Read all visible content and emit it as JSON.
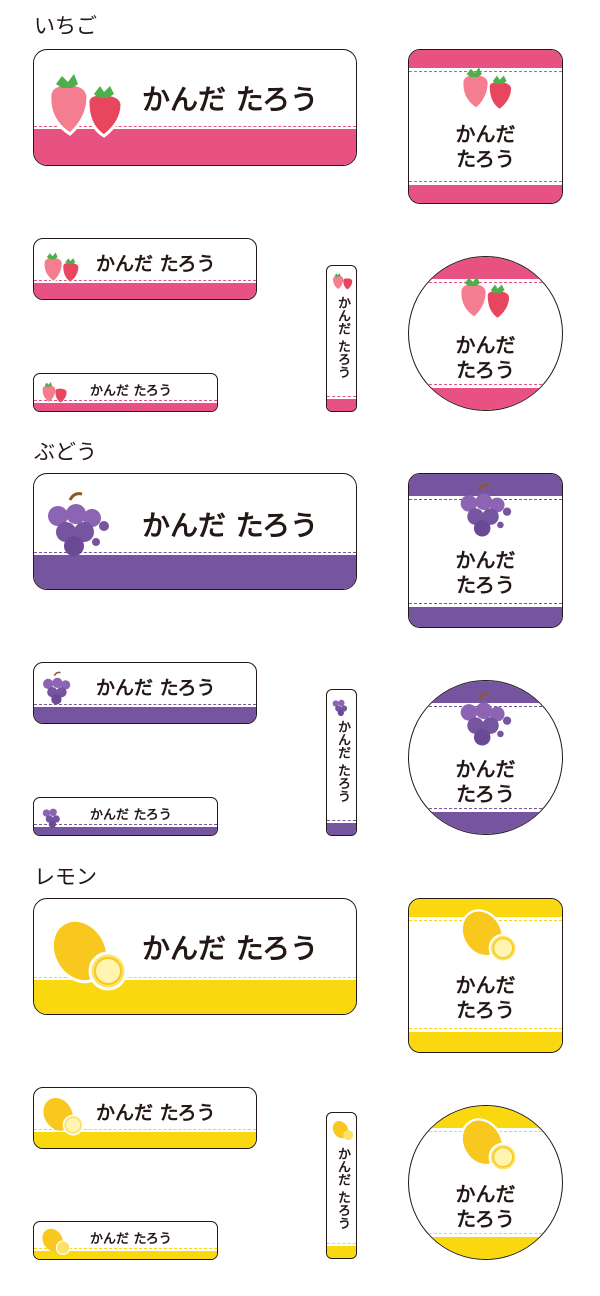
{
  "sections": [
    {
      "key": "ichigo",
      "title": "いちご",
      "color": "#e85282",
      "dash": "#e85282"
    },
    {
      "key": "budou",
      "title": "ぶどう",
      "color": "#7655a0",
      "dash": "#7655a0"
    },
    {
      "key": "lemon",
      "title": "レモン",
      "color": "#f9d80f",
      "dash": "#f9d80f"
    }
  ],
  "name_text": "かんだ たろう",
  "name_two_line": {
    "line1": "かんだ",
    "line2": "たろう"
  },
  "name_vertical": "かんだ たろう",
  "icons": {
    "ichigo": "strawberry-icon",
    "budou": "grape-icon",
    "lemon": "lemon-icon"
  }
}
